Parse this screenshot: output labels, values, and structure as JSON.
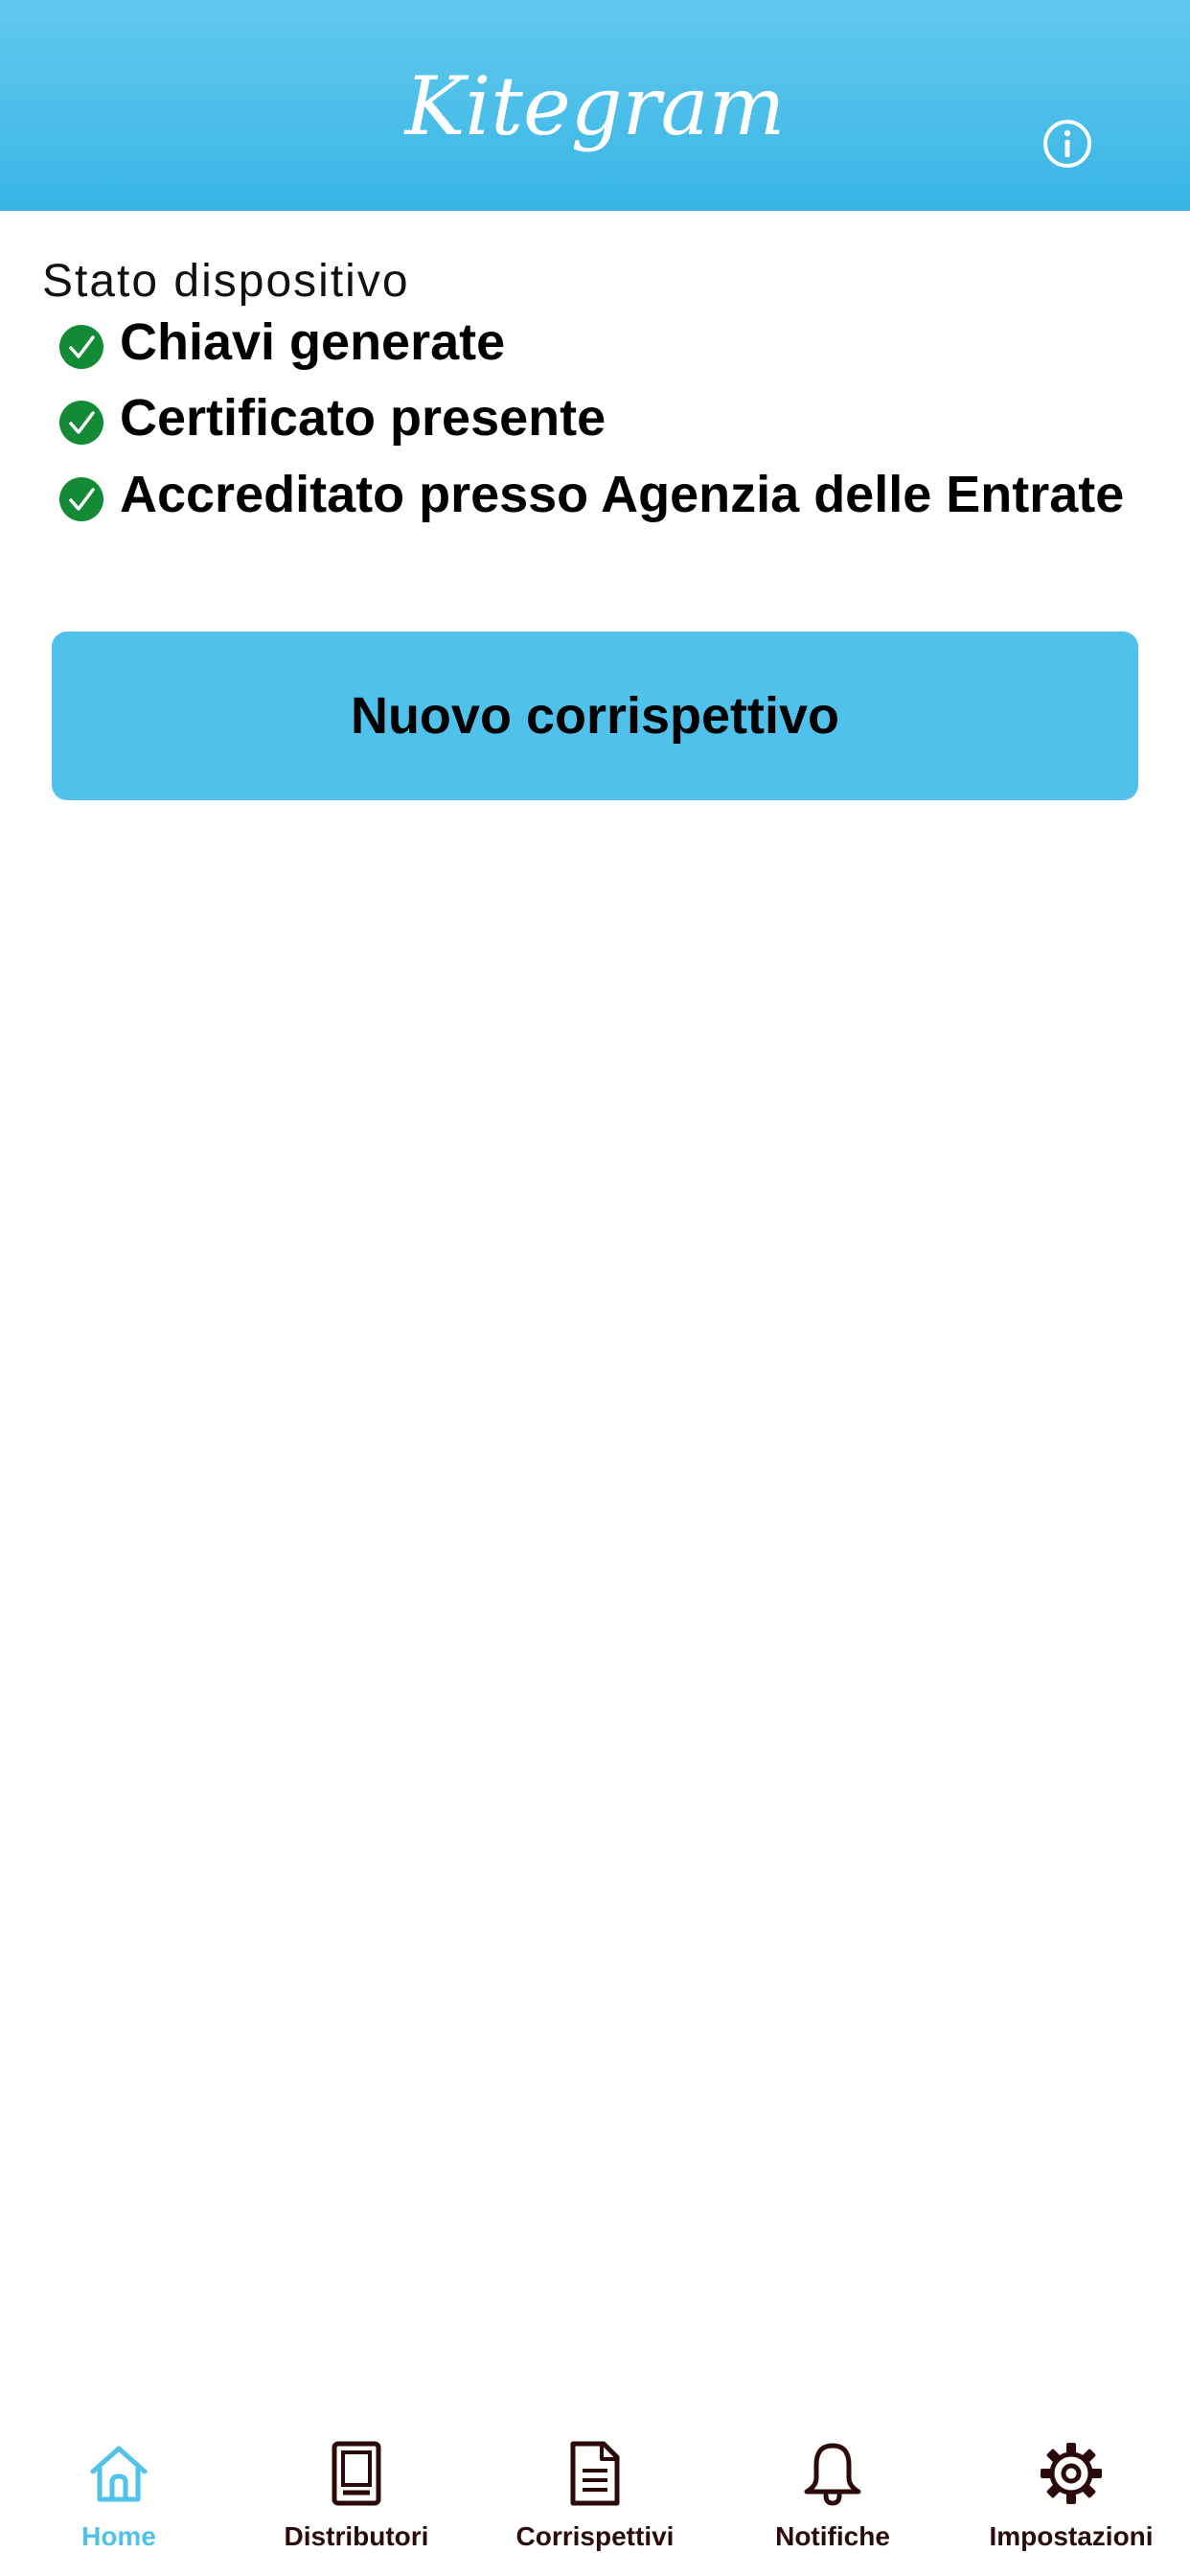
{
  "app": {
    "title": "Kitegram"
  },
  "header": {
    "info_icon": "info-circle-icon"
  },
  "status": {
    "title": "Stato dispositivo",
    "items": [
      {
        "label": "Chiavi generate",
        "icon": "check-circle-icon",
        "state": "ok"
      },
      {
        "label": "Certificato presente",
        "icon": "check-circle-icon",
        "state": "ok"
      },
      {
        "label": "Accreditato presso Agenzia delle Entrate",
        "icon": "check-circle-icon",
        "state": "ok"
      }
    ]
  },
  "actions": {
    "new_receipt_label": "Nuovo corrispettivo"
  },
  "tabbar": {
    "items": [
      {
        "label": "Home",
        "icon": "home-icon",
        "active": true
      },
      {
        "label": "Distributori",
        "icon": "device-icon",
        "active": false
      },
      {
        "label": "Corrispettivi",
        "icon": "document-icon",
        "active": false
      },
      {
        "label": "Notifiche",
        "icon": "bell-icon",
        "active": false
      },
      {
        "label": "Impostazioni",
        "icon": "gear-icon",
        "active": false
      }
    ]
  },
  "colors": {
    "header_gradient_top": "#62c9ee",
    "header_gradient_bottom": "#39b5e6",
    "accent": "#4fc1ea",
    "check_green": "#138a36",
    "tab_inactive": "#2a0a0a"
  }
}
